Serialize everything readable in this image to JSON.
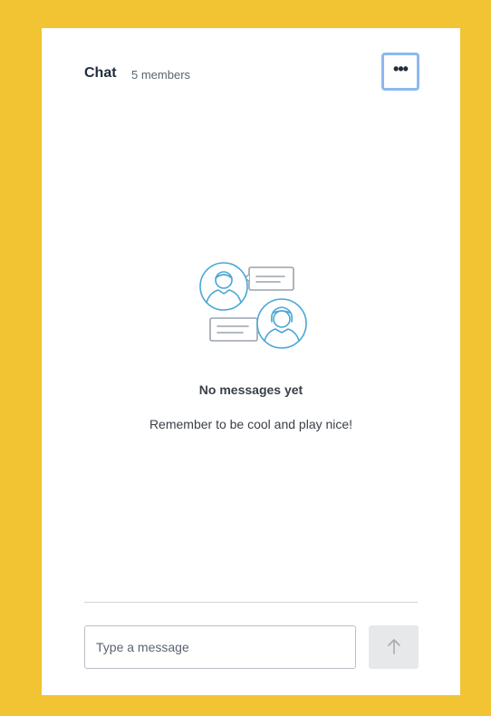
{
  "chat": {
    "title": "Chat",
    "members": "5 members",
    "menu_label": "•••",
    "menu_icon": "more-horizontal-icon"
  },
  "empty_state": {
    "illustration_icon": "chat-people-icon",
    "title": "No messages yet",
    "subtitle": "Remember to be cool and play nice!"
  },
  "composer": {
    "placeholder": "Type a message",
    "value": "",
    "send_icon": "arrow-up-icon",
    "send_enabled": false
  },
  "colors": {
    "frame_background": "#F2C332",
    "accent_blue": "#4BA6D6",
    "text_dark": "#1F2D3D",
    "send_button_disabled": "#E6E8EA"
  }
}
